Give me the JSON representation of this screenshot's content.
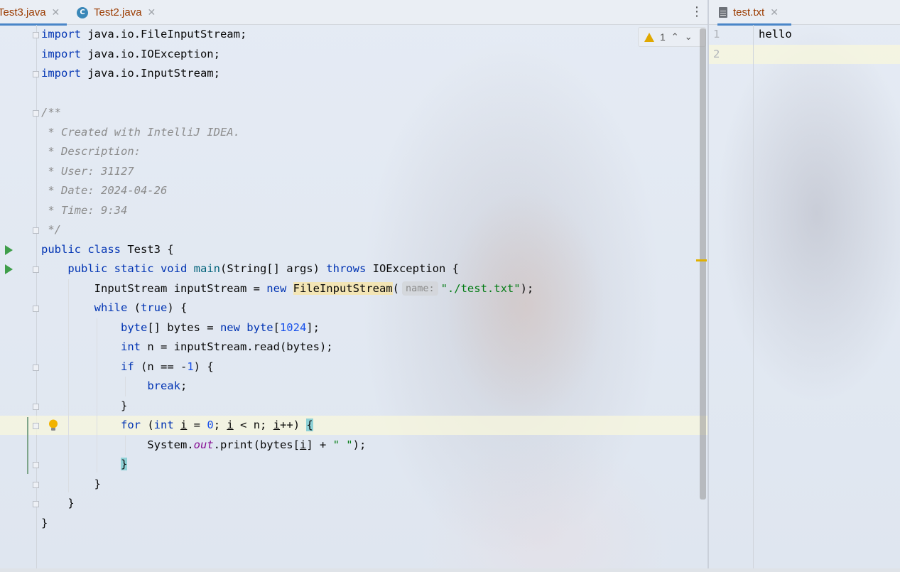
{
  "editor_left": {
    "tabs": [
      {
        "label": "Test3.java",
        "active": true
      },
      {
        "label": "Test2.java",
        "active": false
      }
    ],
    "inspection": {
      "warning_count": "1"
    },
    "code_lines": [
      "import java.io.FileInputStream;",
      "import java.io.IOException;",
      "import java.io.InputStream;",
      "",
      "/**",
      " * Created with IntelliJ IDEA.",
      " * Description:",
      " * User: 31127",
      " * Date: 2024-04-26",
      " * Time: 9:34",
      " */",
      "public class Test3 {",
      "    public static void main(String[] args) throws IOException {",
      "        InputStream inputStream = new FileInputStream(\"./test.txt\");",
      "        while (true) {",
      "            byte[] bytes = new byte[1024];",
      "            int n = inputStream.read(bytes);",
      "            if (n == -1) {",
      "                break;",
      "            }",
      "            for (int i = 0; i < n; i++) {",
      "                System.out.print(bytes[i] + \" \");",
      "            }",
      "        }",
      "    }",
      "}"
    ],
    "param_hint": "name:"
  },
  "editor_right": {
    "tab": {
      "label": "test.txt"
    },
    "line_numbers": [
      "1",
      "2"
    ],
    "lines": [
      "hello",
      ""
    ]
  },
  "colors": {
    "keyword": "#0033b3",
    "comment": "#8c8c8c",
    "string": "#067d17",
    "number": "#1750eb",
    "static_field": "#871094",
    "tab_label": "#9b3b00"
  }
}
